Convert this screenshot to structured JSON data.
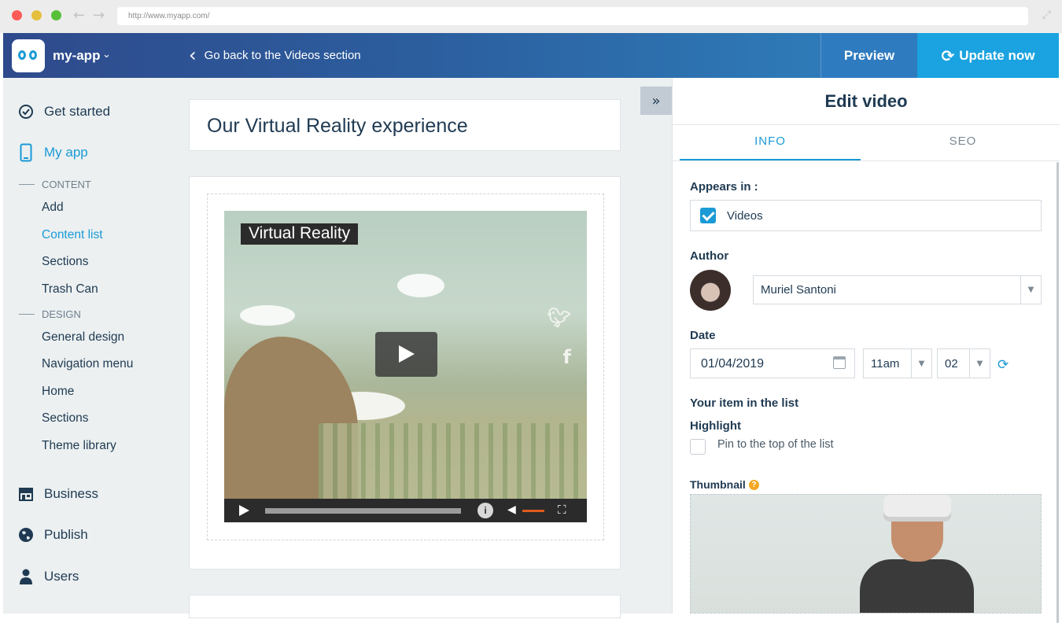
{
  "browser": {
    "url": "http://www.myapp.com/"
  },
  "header": {
    "app_name": "my-app",
    "back_label": "Go back to the Videos section",
    "preview_label": "Preview",
    "update_label": "Update now"
  },
  "sidebar": {
    "main_items": [
      {
        "label": "Get started",
        "icon": "check-circle-icon"
      },
      {
        "label": "My app",
        "icon": "phone-icon",
        "active": true
      },
      {
        "label": "Business",
        "icon": "store-icon"
      },
      {
        "label": "Publish",
        "icon": "globe-icon"
      },
      {
        "label": "Users",
        "icon": "user-icon"
      }
    ],
    "groups": [
      {
        "label": "CONTENT",
        "items": [
          "Add",
          "Content list",
          "Sections",
          "Trash Can"
        ],
        "active": "Content list"
      },
      {
        "label": "DESIGN",
        "items": [
          "General design",
          "Navigation menu",
          "Home",
          "Sections",
          "Theme library"
        ]
      }
    ]
  },
  "content": {
    "page_title": "Our Virtual Reality experience",
    "video_label": "Virtual Reality"
  },
  "panel": {
    "title": "Edit video",
    "tabs": [
      "INFO",
      "SEO"
    ],
    "active_tab": "INFO",
    "appears_in_label": "Appears in :",
    "appears_in_option": "Videos",
    "appears_in_checked": true,
    "author_label": "Author",
    "author_value": "Muriel Santoni",
    "date_label": "Date",
    "date_value": "01/04/2019",
    "hour_value": "11am",
    "minute_value": "02",
    "list_section_label": "Your item in the list",
    "highlight_label": "Highlight",
    "pin_label": "Pin to the top of the list",
    "pin_checked": false,
    "thumbnail_label": "Thumbnail"
  },
  "colors": {
    "accent": "#1a9ad6",
    "header_start": "#2e4a8c",
    "header_end": "#2f8cc8",
    "text_dark": "#1f3a52",
    "progress_orange": "#e05b1e"
  }
}
